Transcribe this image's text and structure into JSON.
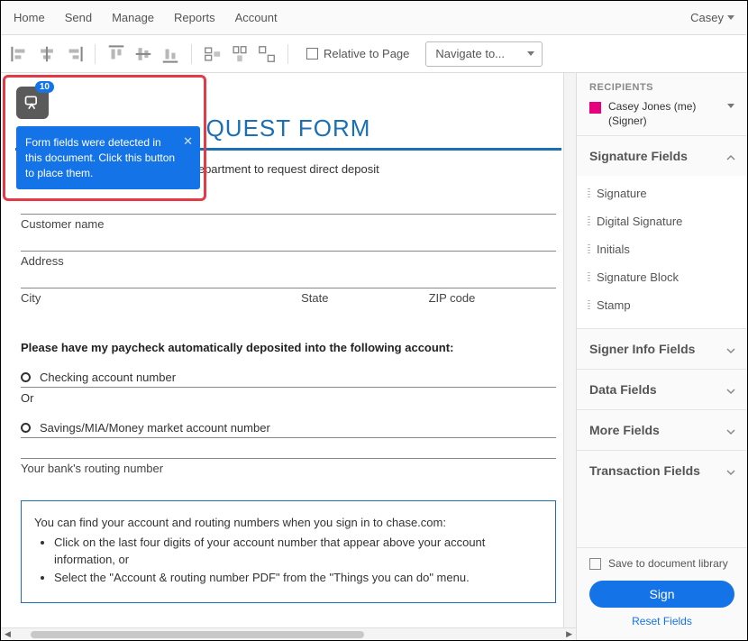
{
  "topnav": {
    "items": [
      "Home",
      "Send",
      "Manage",
      "Reports",
      "Account"
    ],
    "user": "Casey"
  },
  "toolbar": {
    "relative": "Relative to Page",
    "navigate": "Navigate to..."
  },
  "popup": {
    "badge": "10",
    "message": "Form fields were detected in this document. Click this button to place them."
  },
  "doc": {
    "title": "QUEST FORM",
    "subtitle": "take it to your employer's payroll department to request direct deposit",
    "customer": "Customer name",
    "address": "Address",
    "city": "City",
    "state": "State",
    "zip": "ZIP code",
    "instruction": "Please have my paycheck automatically deposited into the following account:",
    "checking": "Checking account number",
    "or": "Or",
    "savings": "Savings/MIA/Money market account number",
    "routing": "Your bank's routing number",
    "note_head": "You can find your account and routing numbers when you sign in to chase.com:",
    "note1": "Click on the last four digits of your account number that appear above your account information, or",
    "note2": "Select the \"Account & routing number PDF\" from the \"Things you can do\" menu."
  },
  "sidebar": {
    "recipients_label": "RECIPIENTS",
    "recipient_name": "Casey Jones (me)",
    "recipient_role": "(Signer)",
    "sig_fields": "Signature Fields",
    "sig_items": [
      "Signature",
      "Digital Signature",
      "Initials",
      "Signature Block",
      "Stamp"
    ],
    "signer_info": "Signer Info Fields",
    "data_fields": "Data Fields",
    "more_fields": "More Fields",
    "txn_fields": "Transaction Fields",
    "save_lib": "Save to document library",
    "sign": "Sign",
    "reset": "Reset Fields"
  }
}
